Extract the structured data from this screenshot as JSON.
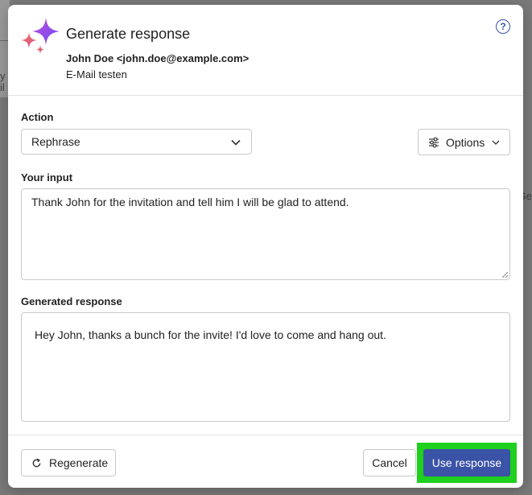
{
  "background": {
    "left_fragment": "y D\nil",
    "right_fragment": "Ge"
  },
  "dialog": {
    "title": "Generate response",
    "sender": "John Doe <john.doe@example.com>",
    "subject": "E-Mail testen",
    "help_icon": "?"
  },
  "action": {
    "label": "Action",
    "selected": "Rephrase",
    "options_label": "Options"
  },
  "input": {
    "label": "Your input",
    "value": "Thank John for the invitation and tell him I will be glad to attend."
  },
  "response": {
    "label": "Generated response",
    "value": "Hey John, thanks a bunch for the invite! I'd love to come and hang out."
  },
  "footer": {
    "regenerate_label": "Regenerate",
    "cancel_label": "Cancel",
    "use_label": "Use response"
  },
  "colors": {
    "accent": "#3b53a6",
    "highlight": "#1fd01f",
    "backdrop": "#7a7a7a"
  },
  "icons": [
    "sparkle-icon",
    "help-icon",
    "chevron-down-icon",
    "sliders-icon",
    "refresh-icon",
    "resize-grip-icon"
  ]
}
